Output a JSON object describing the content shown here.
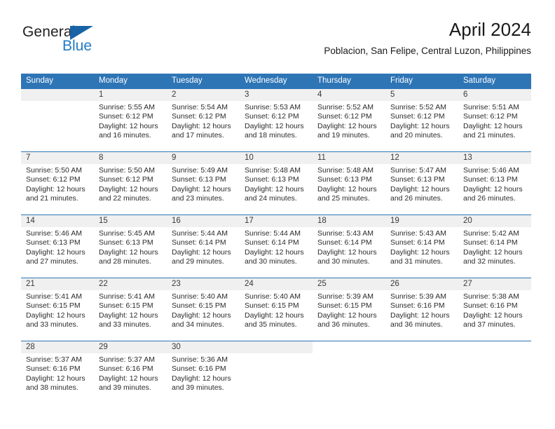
{
  "brand": {
    "name_top": "General",
    "name_bottom": "Blue",
    "triangle_icon": "triangle-icon",
    "color_dark": "#231f20",
    "color_blue": "#1f7ac4"
  },
  "header": {
    "title": "April 2024",
    "subtitle": "Poblacion, San Felipe, Central Luzon, Philippines"
  },
  "theme": {
    "header_bg": "#2e75b6",
    "header_text": "#ffffff",
    "daynum_bg": "#f0f0f0",
    "row_border": "#2e75b6"
  },
  "calendar": {
    "weekday_headers": [
      "Sunday",
      "Monday",
      "Tuesday",
      "Wednesday",
      "Thursday",
      "Friday",
      "Saturday"
    ],
    "weeks": [
      [
        {
          "day": "",
          "sunrise": "",
          "sunset": "",
          "daylight": "",
          "empty": true
        },
        {
          "day": "1",
          "sunrise": "Sunrise: 5:55 AM",
          "sunset": "Sunset: 6:12 PM",
          "daylight": "Daylight: 12 hours and 16 minutes."
        },
        {
          "day": "2",
          "sunrise": "Sunrise: 5:54 AM",
          "sunset": "Sunset: 6:12 PM",
          "daylight": "Daylight: 12 hours and 17 minutes."
        },
        {
          "day": "3",
          "sunrise": "Sunrise: 5:53 AM",
          "sunset": "Sunset: 6:12 PM",
          "daylight": "Daylight: 12 hours and 18 minutes."
        },
        {
          "day": "4",
          "sunrise": "Sunrise: 5:52 AM",
          "sunset": "Sunset: 6:12 PM",
          "daylight": "Daylight: 12 hours and 19 minutes."
        },
        {
          "day": "5",
          "sunrise": "Sunrise: 5:52 AM",
          "sunset": "Sunset: 6:12 PM",
          "daylight": "Daylight: 12 hours and 20 minutes."
        },
        {
          "day": "6",
          "sunrise": "Sunrise: 5:51 AM",
          "sunset": "Sunset: 6:12 PM",
          "daylight": "Daylight: 12 hours and 21 minutes."
        }
      ],
      [
        {
          "day": "7",
          "sunrise": "Sunrise: 5:50 AM",
          "sunset": "Sunset: 6:12 PM",
          "daylight": "Daylight: 12 hours and 21 minutes."
        },
        {
          "day": "8",
          "sunrise": "Sunrise: 5:50 AM",
          "sunset": "Sunset: 6:12 PM",
          "daylight": "Daylight: 12 hours and 22 minutes."
        },
        {
          "day": "9",
          "sunrise": "Sunrise: 5:49 AM",
          "sunset": "Sunset: 6:13 PM",
          "daylight": "Daylight: 12 hours and 23 minutes."
        },
        {
          "day": "10",
          "sunrise": "Sunrise: 5:48 AM",
          "sunset": "Sunset: 6:13 PM",
          "daylight": "Daylight: 12 hours and 24 minutes."
        },
        {
          "day": "11",
          "sunrise": "Sunrise: 5:48 AM",
          "sunset": "Sunset: 6:13 PM",
          "daylight": "Daylight: 12 hours and 25 minutes."
        },
        {
          "day": "12",
          "sunrise": "Sunrise: 5:47 AM",
          "sunset": "Sunset: 6:13 PM",
          "daylight": "Daylight: 12 hours and 26 minutes."
        },
        {
          "day": "13",
          "sunrise": "Sunrise: 5:46 AM",
          "sunset": "Sunset: 6:13 PM",
          "daylight": "Daylight: 12 hours and 26 minutes."
        }
      ],
      [
        {
          "day": "14",
          "sunrise": "Sunrise: 5:46 AM",
          "sunset": "Sunset: 6:13 PM",
          "daylight": "Daylight: 12 hours and 27 minutes."
        },
        {
          "day": "15",
          "sunrise": "Sunrise: 5:45 AM",
          "sunset": "Sunset: 6:13 PM",
          "daylight": "Daylight: 12 hours and 28 minutes."
        },
        {
          "day": "16",
          "sunrise": "Sunrise: 5:44 AM",
          "sunset": "Sunset: 6:14 PM",
          "daylight": "Daylight: 12 hours and 29 minutes."
        },
        {
          "day": "17",
          "sunrise": "Sunrise: 5:44 AM",
          "sunset": "Sunset: 6:14 PM",
          "daylight": "Daylight: 12 hours and 30 minutes."
        },
        {
          "day": "18",
          "sunrise": "Sunrise: 5:43 AM",
          "sunset": "Sunset: 6:14 PM",
          "daylight": "Daylight: 12 hours and 30 minutes."
        },
        {
          "day": "19",
          "sunrise": "Sunrise: 5:43 AM",
          "sunset": "Sunset: 6:14 PM",
          "daylight": "Daylight: 12 hours and 31 minutes."
        },
        {
          "day": "20",
          "sunrise": "Sunrise: 5:42 AM",
          "sunset": "Sunset: 6:14 PM",
          "daylight": "Daylight: 12 hours and 32 minutes."
        }
      ],
      [
        {
          "day": "21",
          "sunrise": "Sunrise: 5:41 AM",
          "sunset": "Sunset: 6:15 PM",
          "daylight": "Daylight: 12 hours and 33 minutes."
        },
        {
          "day": "22",
          "sunrise": "Sunrise: 5:41 AM",
          "sunset": "Sunset: 6:15 PM",
          "daylight": "Daylight: 12 hours and 33 minutes."
        },
        {
          "day": "23",
          "sunrise": "Sunrise: 5:40 AM",
          "sunset": "Sunset: 6:15 PM",
          "daylight": "Daylight: 12 hours and 34 minutes."
        },
        {
          "day": "24",
          "sunrise": "Sunrise: 5:40 AM",
          "sunset": "Sunset: 6:15 PM",
          "daylight": "Daylight: 12 hours and 35 minutes."
        },
        {
          "day": "25",
          "sunrise": "Sunrise: 5:39 AM",
          "sunset": "Sunset: 6:15 PM",
          "daylight": "Daylight: 12 hours and 36 minutes."
        },
        {
          "day": "26",
          "sunrise": "Sunrise: 5:39 AM",
          "sunset": "Sunset: 6:16 PM",
          "daylight": "Daylight: 12 hours and 36 minutes."
        },
        {
          "day": "27",
          "sunrise": "Sunrise: 5:38 AM",
          "sunset": "Sunset: 6:16 PM",
          "daylight": "Daylight: 12 hours and 37 minutes."
        }
      ],
      [
        {
          "day": "28",
          "sunrise": "Sunrise: 5:37 AM",
          "sunset": "Sunset: 6:16 PM",
          "daylight": "Daylight: 12 hours and 38 minutes."
        },
        {
          "day": "29",
          "sunrise": "Sunrise: 5:37 AM",
          "sunset": "Sunset: 6:16 PM",
          "daylight": "Daylight: 12 hours and 39 minutes."
        },
        {
          "day": "30",
          "sunrise": "Sunrise: 5:36 AM",
          "sunset": "Sunset: 6:16 PM",
          "daylight": "Daylight: 12 hours and 39 minutes."
        },
        {
          "day": "",
          "sunrise": "",
          "sunset": "",
          "daylight": "",
          "empty": true
        },
        {
          "day": "",
          "sunrise": "",
          "sunset": "",
          "daylight": "",
          "blank": true
        },
        {
          "day": "",
          "sunrise": "",
          "sunset": "",
          "daylight": "",
          "blank": true
        },
        {
          "day": "",
          "sunrise": "",
          "sunset": "",
          "daylight": "",
          "blank": true
        }
      ]
    ]
  }
}
